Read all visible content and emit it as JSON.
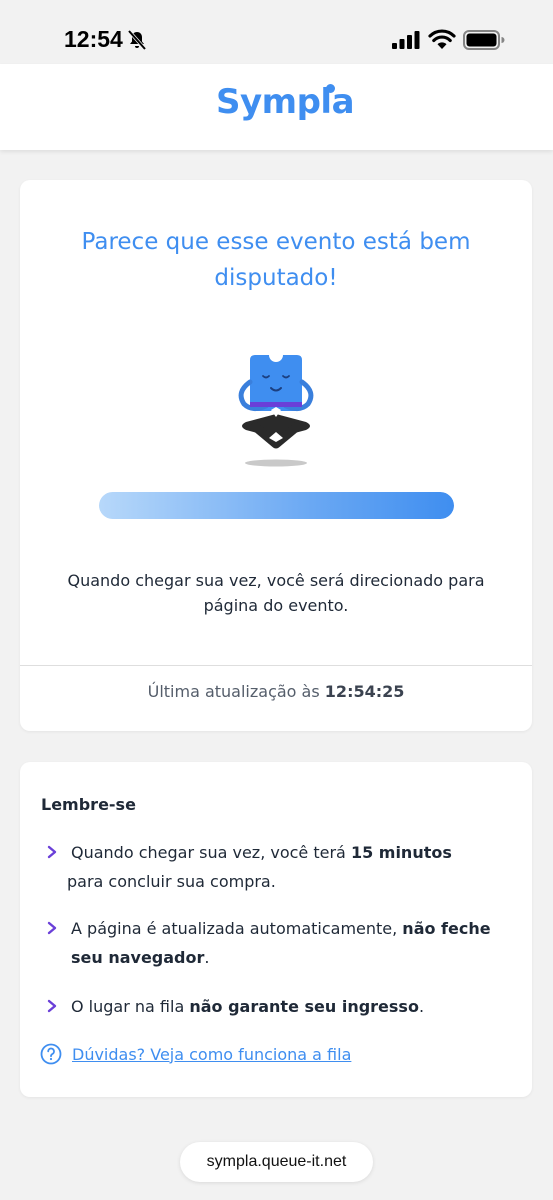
{
  "status_bar": {
    "time": "12:54",
    "icons": [
      "bell-slash-icon",
      "signal-icon",
      "wifi-icon",
      "battery-icon"
    ]
  },
  "header": {
    "logo_text": "Sympla",
    "brand_color": "#3f8ef0"
  },
  "queue_card": {
    "title": "Parece que esse evento está bem disputado!",
    "progress_fraction": 1.0,
    "redirect_message": "Quando chegar sua vez, você será direcionado para página do evento.",
    "last_update_label": "Última atualização às",
    "last_update_time": "12:54:25"
  },
  "info_card": {
    "heading": "Lembre-se",
    "tips": [
      {
        "prefix": "Quando chegar sua vez, você terá ",
        "bold": "15 minutos",
        "suffix": " para concluir sua compra."
      },
      {
        "prefix": "A página é atualizada automaticamente, ",
        "bold": "não feche seu navegador",
        "suffix": "."
      },
      {
        "prefix": "O lugar na fila ",
        "bold": "não garante seu ingresso",
        "suffix": "."
      }
    ],
    "help_link": "Dúvidas? Veja como funciona a fila"
  },
  "browser": {
    "url": "sympla.queue-it.net"
  }
}
